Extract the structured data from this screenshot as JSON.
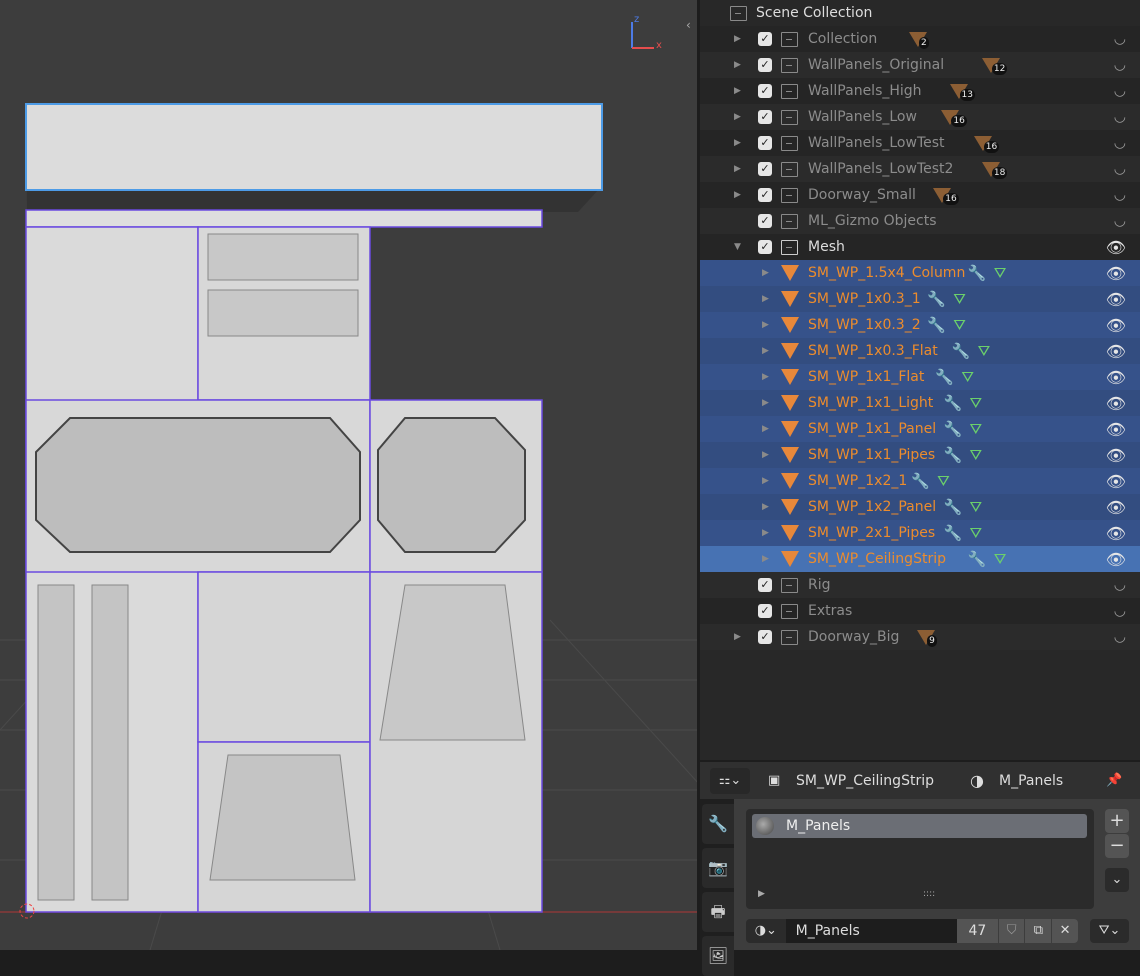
{
  "viewport": {
    "gizmo_axis_z": "z",
    "gizmo_axis_x": "x"
  },
  "outliner": {
    "root": "Scene Collection",
    "collections": [
      {
        "name": "Collection",
        "count": "2"
      },
      {
        "name": "WallPanels_Original",
        "count": "12"
      },
      {
        "name": "WallPanels_High",
        "count": "13"
      },
      {
        "name": "WallPanels_Low",
        "count": "16"
      },
      {
        "name": "WallPanels_LowTest",
        "count": "16"
      },
      {
        "name": "WallPanels_LowTest2",
        "count": "18"
      },
      {
        "name": "Doorway_Small",
        "count": "16"
      },
      {
        "name": "ML_Gizmo Objects",
        "count": ""
      }
    ],
    "mesh": {
      "name": "Mesh",
      "children": [
        "SM_WP_1.5x4_Column",
        "SM_WP_1x0.3_1",
        "SM_WP_1x0.3_2",
        "SM_WP_1x0.3_Flat",
        "SM_WP_1x1_Flat",
        "SM_WP_1x1_Light",
        "SM_WP_1x1_Panel",
        "SM_WP_1x1_Pipes",
        "SM_WP_1x2_1",
        "SM_WP_1x2_Panel",
        "SM_WP_2x1_Pipes",
        "SM_WP_CeilingStrip"
      ]
    },
    "after": [
      {
        "name": "Rig",
        "count": ""
      },
      {
        "name": "Extras",
        "count": ""
      },
      {
        "name": "Doorway_Big",
        "count": "9"
      }
    ]
  },
  "properties": {
    "breadcrumb_object": "SM_WP_CeilingStrip",
    "breadcrumb_material": "M_Panels",
    "slots": [
      "M_Panels"
    ],
    "material_name": "M_Panels",
    "users": "47",
    "add": "+",
    "remove": "−",
    "grip": "::::"
  }
}
